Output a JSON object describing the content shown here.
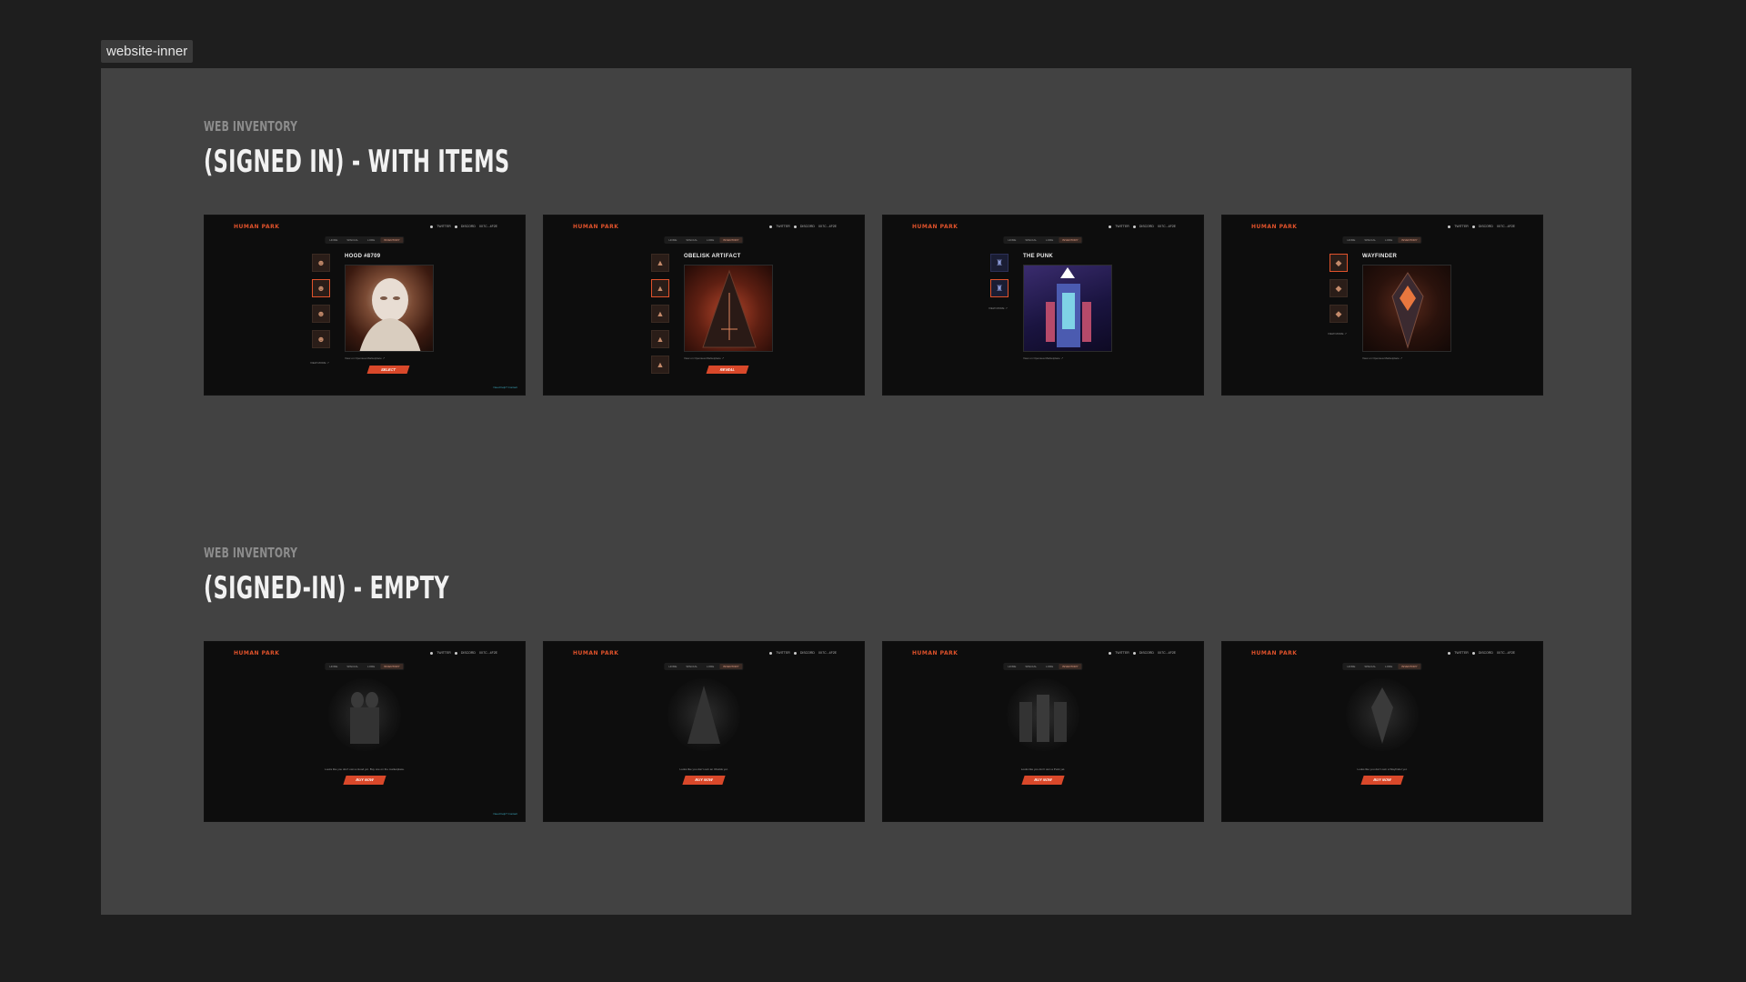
{
  "frame_label": "website-inner",
  "sections": [
    {
      "eyebrow": "WEB INVENTORY",
      "title": "(SIGNED IN) - WITH ITEMS"
    },
    {
      "eyebrow": "WEB INVENTORY",
      "title": "(SIGNED-IN) - EMPTY"
    }
  ],
  "mini": {
    "brand": "HUMAN PARK",
    "nav": [
      "TWITTER",
      "DISCORD",
      "0X7C...4F2E"
    ],
    "tabs": [
      "HOME",
      "SPECIAL",
      "LORE",
      "INVENTORY"
    ],
    "active_tab": "INVENTORY"
  },
  "items": [
    {
      "title": "HOOD #8709",
      "meta": "View on Opensea Marketplace ↗",
      "cta": "SELECT",
      "side_link": "VIEW MORE ↗",
      "corner_link": "Need help? Contact"
    },
    {
      "title": "OBELISK ARTIFACT",
      "meta": "View on Opensea Marketplace ↗",
      "cta": "REVEAL",
      "side_link": "",
      "corner_link": ""
    },
    {
      "title": "THE PUNK",
      "meta": "View on Opensea Marketplace ↗",
      "cta": "",
      "side_link": "VIEW MORE ↗",
      "corner_link": ""
    },
    {
      "title": "WAYFINDER",
      "meta": "View on Opensea Marketplace ↗",
      "cta": "",
      "side_link": "VIEW MORE ↗",
      "corner_link": ""
    }
  ],
  "empty_states": [
    {
      "text": "Looks like you don't own a Hood yet. Buy one on the marketplace.",
      "cta": "BUY NOW",
      "sub": "",
      "corner_link": "Need help? Contact"
    },
    {
      "text": "Looks like you don't own an Obelisk yet.",
      "cta": "BUY NOW",
      "sub": "",
      "corner_link": ""
    },
    {
      "text": "Looks like you don't own a Punk yet.",
      "cta": "BUY NOW",
      "sub": "",
      "corner_link": ""
    },
    {
      "text": "Looks like you don't own a Wayfinder yet.",
      "cta": "BUY NOW",
      "sub": "",
      "corner_link": ""
    }
  ],
  "colors": {
    "accent": "#d9482a",
    "background": "#1e1e1e",
    "frame": "#424242",
    "screen": "#0d0d0d"
  }
}
